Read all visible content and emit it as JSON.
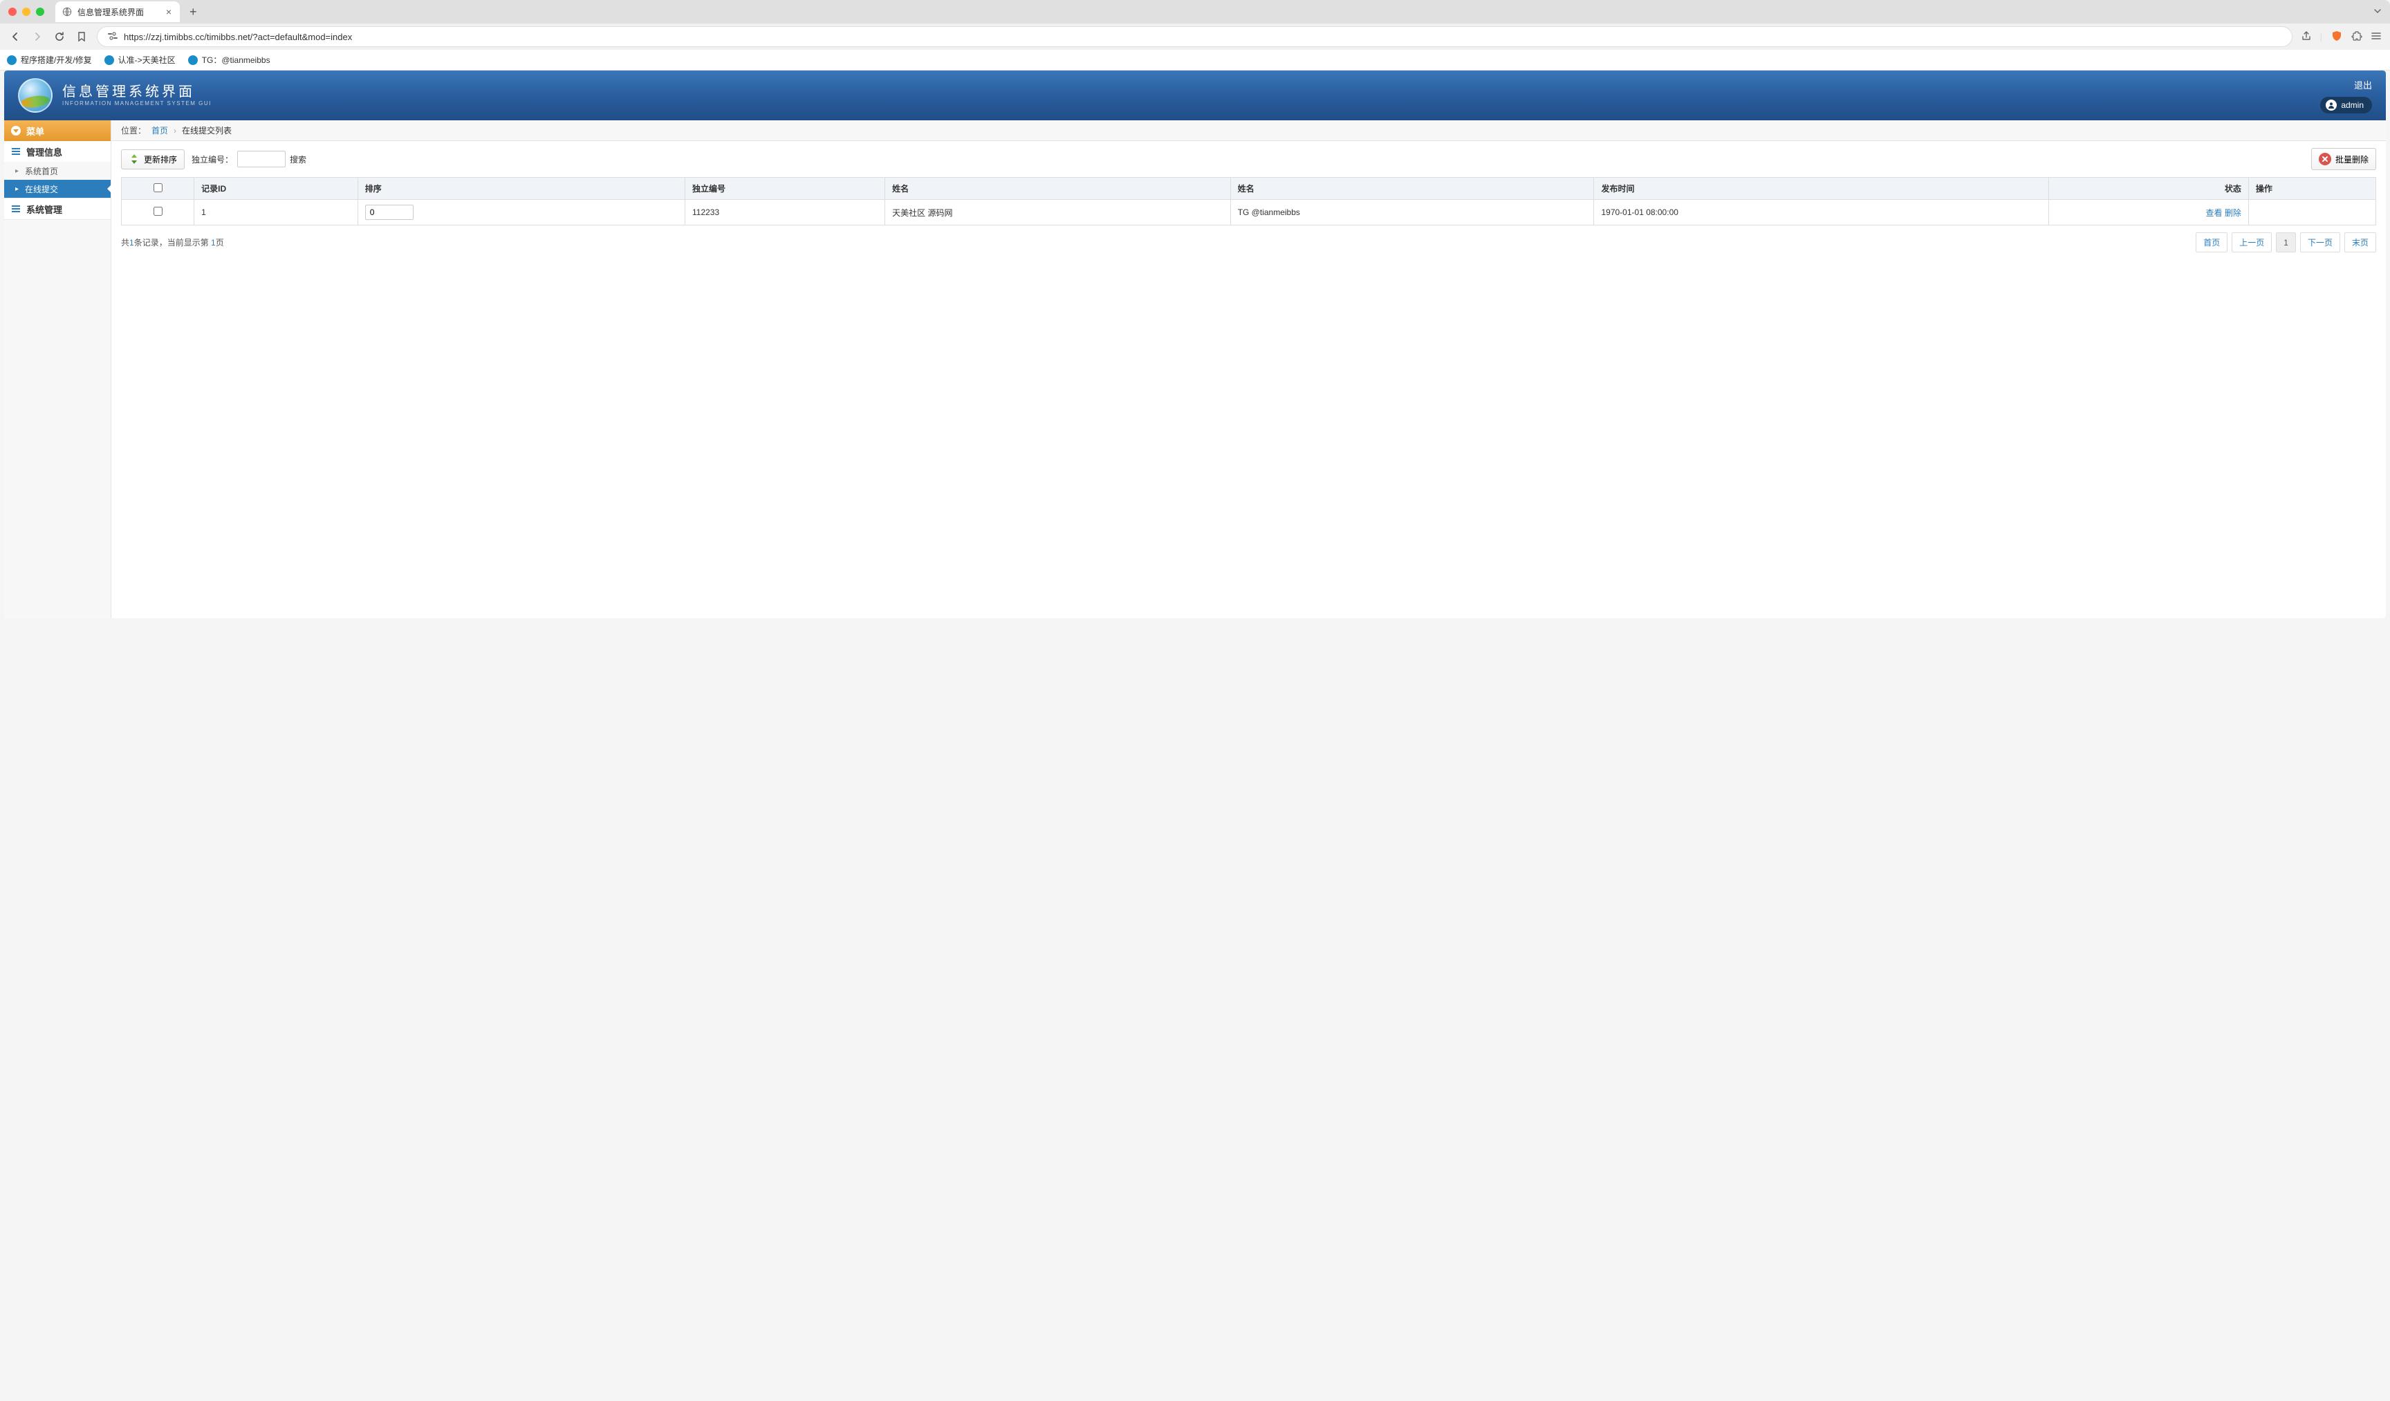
{
  "browser": {
    "tab_title": "信息管理系统界面",
    "url": "https://zzj.timibbs.cc/timibbs.net/?act=default&mod=index",
    "bookmarks": [
      "程序搭建/开发/修复",
      "认准->天美社区",
      "TG：@tianmeibbs"
    ]
  },
  "header": {
    "logo_title": "信息管理系统界面",
    "logo_subtitle": "INFORMATION MANAGEMENT SYSTEM GUI",
    "logout": "退出",
    "username": "admin"
  },
  "sidebar": {
    "menu_title": "菜单",
    "sections": [
      {
        "title": "管理信息",
        "items": [
          {
            "label": "系统首页",
            "active": false
          },
          {
            "label": "在线提交",
            "active": true
          }
        ]
      },
      {
        "title": "系统管理",
        "items": []
      }
    ]
  },
  "breadcrumb": {
    "label": "位置：",
    "home": "首页",
    "current": "在线提交列表"
  },
  "toolbar": {
    "update_sort": "更新排序",
    "code_label": "独立编号：",
    "search_label": "搜索",
    "bulk_delete": "批量删除"
  },
  "table": {
    "headers": {
      "id": "记录ID",
      "sort": "排序",
      "code": "独立编号",
      "name1": "姓名",
      "name2": "姓名",
      "pub_time": "发布时间",
      "status": "状态",
      "action": "操作"
    },
    "rows": [
      {
        "id": "1",
        "sort_value": "0",
        "code": "112233",
        "name1": "天美社区 源码网",
        "name2": "TG @tianmeibbs",
        "pub_time": "1970-01-01 08:00:00",
        "view": "查看",
        "delete": "删除"
      }
    ]
  },
  "footer": {
    "text_prefix": "共",
    "total": "1",
    "text_mid": "条记录，当前显示第 ",
    "page": "1",
    "text_suffix": "页",
    "pagination": {
      "first": "首页",
      "prev": "上一页",
      "current": "1",
      "next": "下一页",
      "last": "末页"
    }
  }
}
